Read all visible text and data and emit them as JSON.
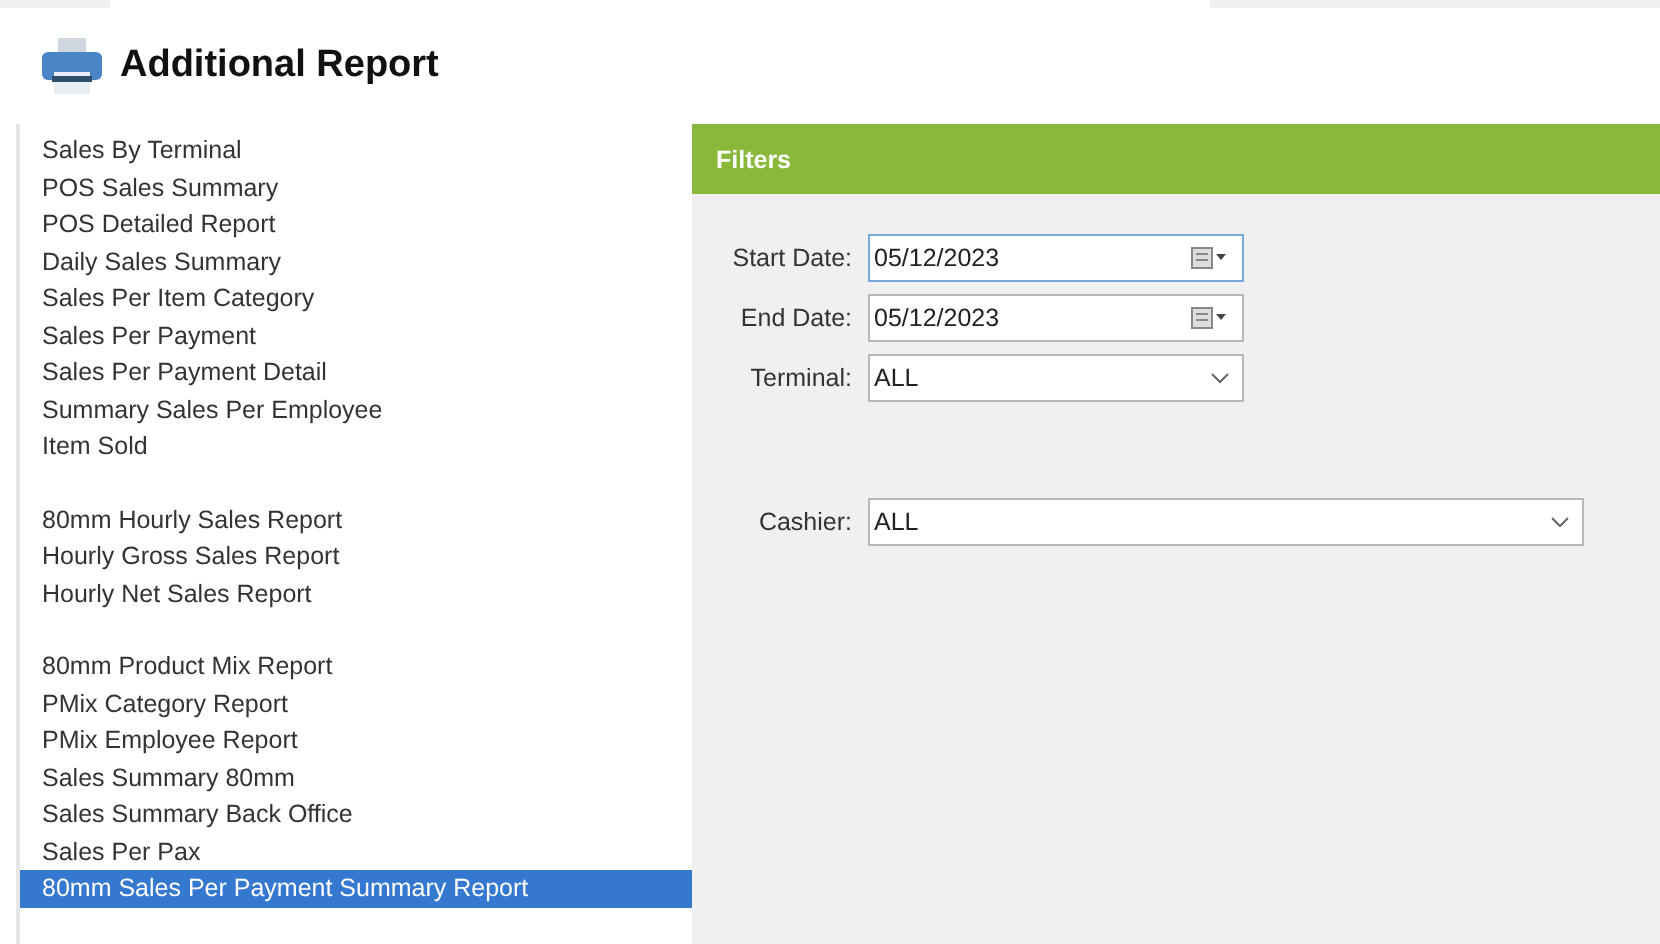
{
  "title": "Additional Report",
  "report_groups": [
    {
      "items": [
        {
          "label": "Sales By Terminal",
          "selected": false
        },
        {
          "label": "POS Sales Summary",
          "selected": false
        },
        {
          "label": "POS Detailed Report",
          "selected": false
        },
        {
          "label": "Daily Sales Summary",
          "selected": false
        },
        {
          "label": "Sales Per Item Category",
          "selected": false
        },
        {
          "label": "Sales Per Payment",
          "selected": false
        },
        {
          "label": "Sales Per Payment Detail",
          "selected": false
        },
        {
          "label": "Summary Sales Per Employee",
          "selected": false
        },
        {
          "label": "Item Sold",
          "selected": false
        }
      ]
    },
    {
      "items": [
        {
          "label": "80mm Hourly Sales Report",
          "selected": false
        },
        {
          "label": "Hourly Gross Sales Report",
          "selected": false
        },
        {
          "label": "Hourly Net Sales Report",
          "selected": false
        }
      ]
    },
    {
      "items": [
        {
          "label": "80mm Product Mix Report",
          "selected": false
        },
        {
          "label": "PMix Category Report",
          "selected": false
        },
        {
          "label": "PMix Employee Report",
          "selected": false
        },
        {
          "label": "Sales Summary 80mm",
          "selected": false
        },
        {
          "label": "Sales Summary Back Office",
          "selected": false
        },
        {
          "label": "Sales Per Pax",
          "selected": false
        },
        {
          "label": "80mm Sales Per Payment Summary Report",
          "selected": true
        }
      ]
    }
  ],
  "filters": {
    "title": "Filters",
    "fields": [
      {
        "kind": "date",
        "label": "Start Date:",
        "value": "05/12/2023",
        "focused": true
      },
      {
        "kind": "date",
        "label": "End Date:",
        "value": "05/12/2023",
        "focused": false
      },
      {
        "kind": "select",
        "label": "Terminal:",
        "value": "ALL",
        "wide": false
      },
      {
        "kind": "select",
        "label": "Cashier:",
        "value": "ALL",
        "wide": true
      }
    ]
  }
}
